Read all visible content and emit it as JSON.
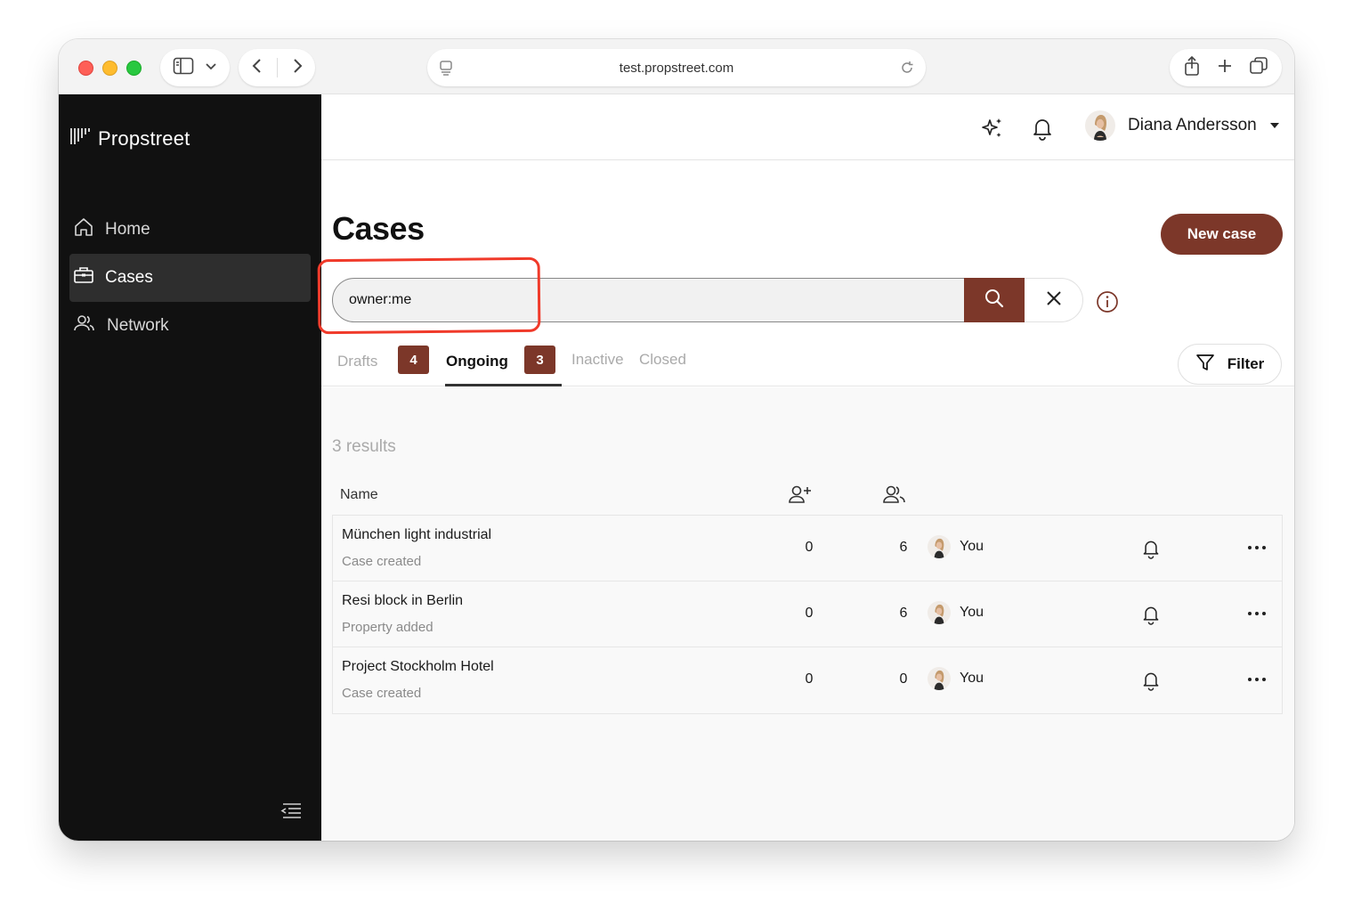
{
  "browser": {
    "url": "test.propstreet.com"
  },
  "sidebar": {
    "brand": "Propstreet",
    "items": [
      {
        "label": "Home",
        "icon": "home-icon"
      },
      {
        "label": "Cases",
        "icon": "briefcase-icon",
        "active": true
      },
      {
        "label": "Network",
        "icon": "people-icon"
      }
    ]
  },
  "topbar": {
    "user_name": "Diana Andersson"
  },
  "page": {
    "title": "Cases",
    "new_case_label": "New case"
  },
  "search": {
    "value": "owner:me"
  },
  "tabs": [
    {
      "label": "Drafts",
      "count": "4"
    },
    {
      "label": "Ongoing",
      "count": "3",
      "active": true
    },
    {
      "label": "Inactive"
    },
    {
      "label": "Closed"
    }
  ],
  "filter_label": "Filter",
  "results": {
    "count_label": "3 results",
    "columns": {
      "name": "Name"
    },
    "rows": [
      {
        "title": "München light industrial",
        "status": "Case created",
        "invited": "0",
        "members": "6",
        "owner": "You"
      },
      {
        "title": "Resi block in Berlin",
        "status": "Property added",
        "invited": "0",
        "members": "6",
        "owner": "You"
      },
      {
        "title": "Project Stockholm Hotel",
        "status": "Case created",
        "invited": "0",
        "members": "0",
        "owner": "You"
      }
    ]
  },
  "colors": {
    "accent": "#7c3729",
    "sidebar_bg": "#111111",
    "annotation": "#f03a2a"
  }
}
